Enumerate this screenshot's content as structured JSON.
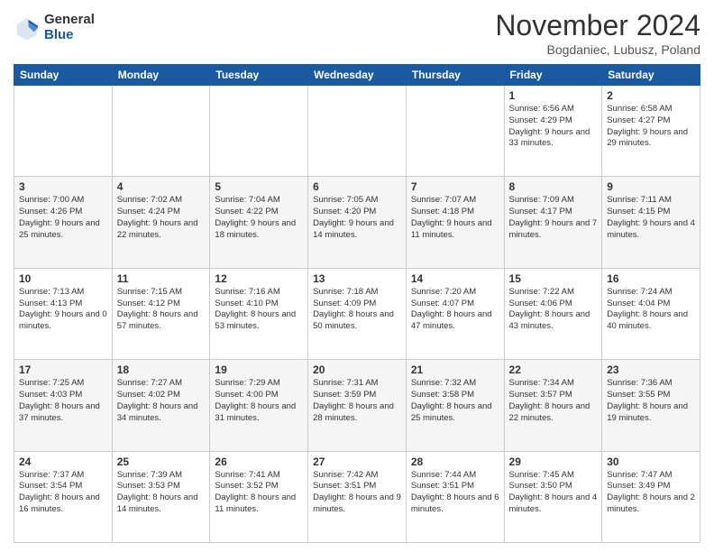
{
  "logo": {
    "general": "General",
    "blue": "Blue"
  },
  "title": "November 2024",
  "location": "Bogdaniec, Lubusz, Poland",
  "days_of_week": [
    "Sunday",
    "Monday",
    "Tuesday",
    "Wednesday",
    "Thursday",
    "Friday",
    "Saturday"
  ],
  "weeks": [
    [
      {
        "day": "",
        "info": ""
      },
      {
        "day": "",
        "info": ""
      },
      {
        "day": "",
        "info": ""
      },
      {
        "day": "",
        "info": ""
      },
      {
        "day": "",
        "info": ""
      },
      {
        "day": "1",
        "info": "Sunrise: 6:56 AM\nSunset: 4:29 PM\nDaylight: 9 hours and 33 minutes."
      },
      {
        "day": "2",
        "info": "Sunrise: 6:58 AM\nSunset: 4:27 PM\nDaylight: 9 hours and 29 minutes."
      }
    ],
    [
      {
        "day": "3",
        "info": "Sunrise: 7:00 AM\nSunset: 4:26 PM\nDaylight: 9 hours and 25 minutes."
      },
      {
        "day": "4",
        "info": "Sunrise: 7:02 AM\nSunset: 4:24 PM\nDaylight: 9 hours and 22 minutes."
      },
      {
        "day": "5",
        "info": "Sunrise: 7:04 AM\nSunset: 4:22 PM\nDaylight: 9 hours and 18 minutes."
      },
      {
        "day": "6",
        "info": "Sunrise: 7:05 AM\nSunset: 4:20 PM\nDaylight: 9 hours and 14 minutes."
      },
      {
        "day": "7",
        "info": "Sunrise: 7:07 AM\nSunset: 4:18 PM\nDaylight: 9 hours and 11 minutes."
      },
      {
        "day": "8",
        "info": "Sunrise: 7:09 AM\nSunset: 4:17 PM\nDaylight: 9 hours and 7 minutes."
      },
      {
        "day": "9",
        "info": "Sunrise: 7:11 AM\nSunset: 4:15 PM\nDaylight: 9 hours and 4 minutes."
      }
    ],
    [
      {
        "day": "10",
        "info": "Sunrise: 7:13 AM\nSunset: 4:13 PM\nDaylight: 9 hours and 0 minutes."
      },
      {
        "day": "11",
        "info": "Sunrise: 7:15 AM\nSunset: 4:12 PM\nDaylight: 8 hours and 57 minutes."
      },
      {
        "day": "12",
        "info": "Sunrise: 7:16 AM\nSunset: 4:10 PM\nDaylight: 8 hours and 53 minutes."
      },
      {
        "day": "13",
        "info": "Sunrise: 7:18 AM\nSunset: 4:09 PM\nDaylight: 8 hours and 50 minutes."
      },
      {
        "day": "14",
        "info": "Sunrise: 7:20 AM\nSunset: 4:07 PM\nDaylight: 8 hours and 47 minutes."
      },
      {
        "day": "15",
        "info": "Sunrise: 7:22 AM\nSunset: 4:06 PM\nDaylight: 8 hours and 43 minutes."
      },
      {
        "day": "16",
        "info": "Sunrise: 7:24 AM\nSunset: 4:04 PM\nDaylight: 8 hours and 40 minutes."
      }
    ],
    [
      {
        "day": "17",
        "info": "Sunrise: 7:25 AM\nSunset: 4:03 PM\nDaylight: 8 hours and 37 minutes."
      },
      {
        "day": "18",
        "info": "Sunrise: 7:27 AM\nSunset: 4:02 PM\nDaylight: 8 hours and 34 minutes."
      },
      {
        "day": "19",
        "info": "Sunrise: 7:29 AM\nSunset: 4:00 PM\nDaylight: 8 hours and 31 minutes."
      },
      {
        "day": "20",
        "info": "Sunrise: 7:31 AM\nSunset: 3:59 PM\nDaylight: 8 hours and 28 minutes."
      },
      {
        "day": "21",
        "info": "Sunrise: 7:32 AM\nSunset: 3:58 PM\nDaylight: 8 hours and 25 minutes."
      },
      {
        "day": "22",
        "info": "Sunrise: 7:34 AM\nSunset: 3:57 PM\nDaylight: 8 hours and 22 minutes."
      },
      {
        "day": "23",
        "info": "Sunrise: 7:36 AM\nSunset: 3:55 PM\nDaylight: 8 hours and 19 minutes."
      }
    ],
    [
      {
        "day": "24",
        "info": "Sunrise: 7:37 AM\nSunset: 3:54 PM\nDaylight: 8 hours and 16 minutes."
      },
      {
        "day": "25",
        "info": "Sunrise: 7:39 AM\nSunset: 3:53 PM\nDaylight: 8 hours and 14 minutes."
      },
      {
        "day": "26",
        "info": "Sunrise: 7:41 AM\nSunset: 3:52 PM\nDaylight: 8 hours and 11 minutes."
      },
      {
        "day": "27",
        "info": "Sunrise: 7:42 AM\nSunset: 3:51 PM\nDaylight: 8 hours and 9 minutes."
      },
      {
        "day": "28",
        "info": "Sunrise: 7:44 AM\nSunset: 3:51 PM\nDaylight: 8 hours and 6 minutes."
      },
      {
        "day": "29",
        "info": "Sunrise: 7:45 AM\nSunset: 3:50 PM\nDaylight: 8 hours and 4 minutes."
      },
      {
        "day": "30",
        "info": "Sunrise: 7:47 AM\nSunset: 3:49 PM\nDaylight: 8 hours and 2 minutes."
      }
    ]
  ]
}
